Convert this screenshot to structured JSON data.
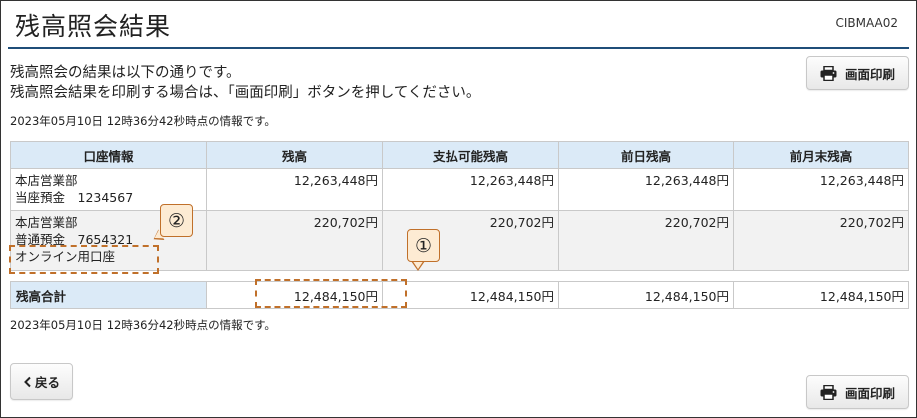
{
  "header": {
    "title": "残高照会結果",
    "screen_id": "CIBMAA02"
  },
  "message": {
    "line1": "残高照会の結果は以下の通りです。",
    "line2": "残高照会結果を印刷する場合は、「画面印刷」ボタンを押してください。"
  },
  "buttons": {
    "print_label": "画面印刷",
    "back_label": "戻る"
  },
  "timestamp": "2023年05月10日 12時36分42秒時点の情報です。",
  "table": {
    "headers": [
      "口座情報",
      "残高",
      "支払可能残高",
      "前日残高",
      "前月末残高"
    ],
    "rows": [
      {
        "branch": "本店営業部",
        "account": "当座預金　1234567",
        "nickname": "",
        "balance": "12,263,448円",
        "available": "12,263,448円",
        "prev_day": "12,263,448円",
        "prev_month_end": "12,263,448円"
      },
      {
        "branch": "本店営業部",
        "account": "普通預金　7654321",
        "nickname": "オンライン用口座",
        "balance": "220,702円",
        "available": "220,702円",
        "prev_day": "220,702円",
        "prev_month_end": "220,702円"
      }
    ],
    "total": {
      "label": "残高合計",
      "balance": "12,484,150円",
      "available": "12,484,150円",
      "prev_day": "12,484,150円",
      "prev_month_end": "12,484,150円"
    }
  },
  "annotations": {
    "callout_1": "①",
    "callout_2": "②",
    "highlight_color": "#c0702a",
    "callout_fill": "#fdebd3"
  },
  "icons": {
    "print": "printer-icon",
    "back": "chevron-left-icon"
  },
  "colors": {
    "header_bg": "#dbeaf7",
    "title_rule": "#1f4e79",
    "alt_row_bg": "#f2f2f2"
  }
}
